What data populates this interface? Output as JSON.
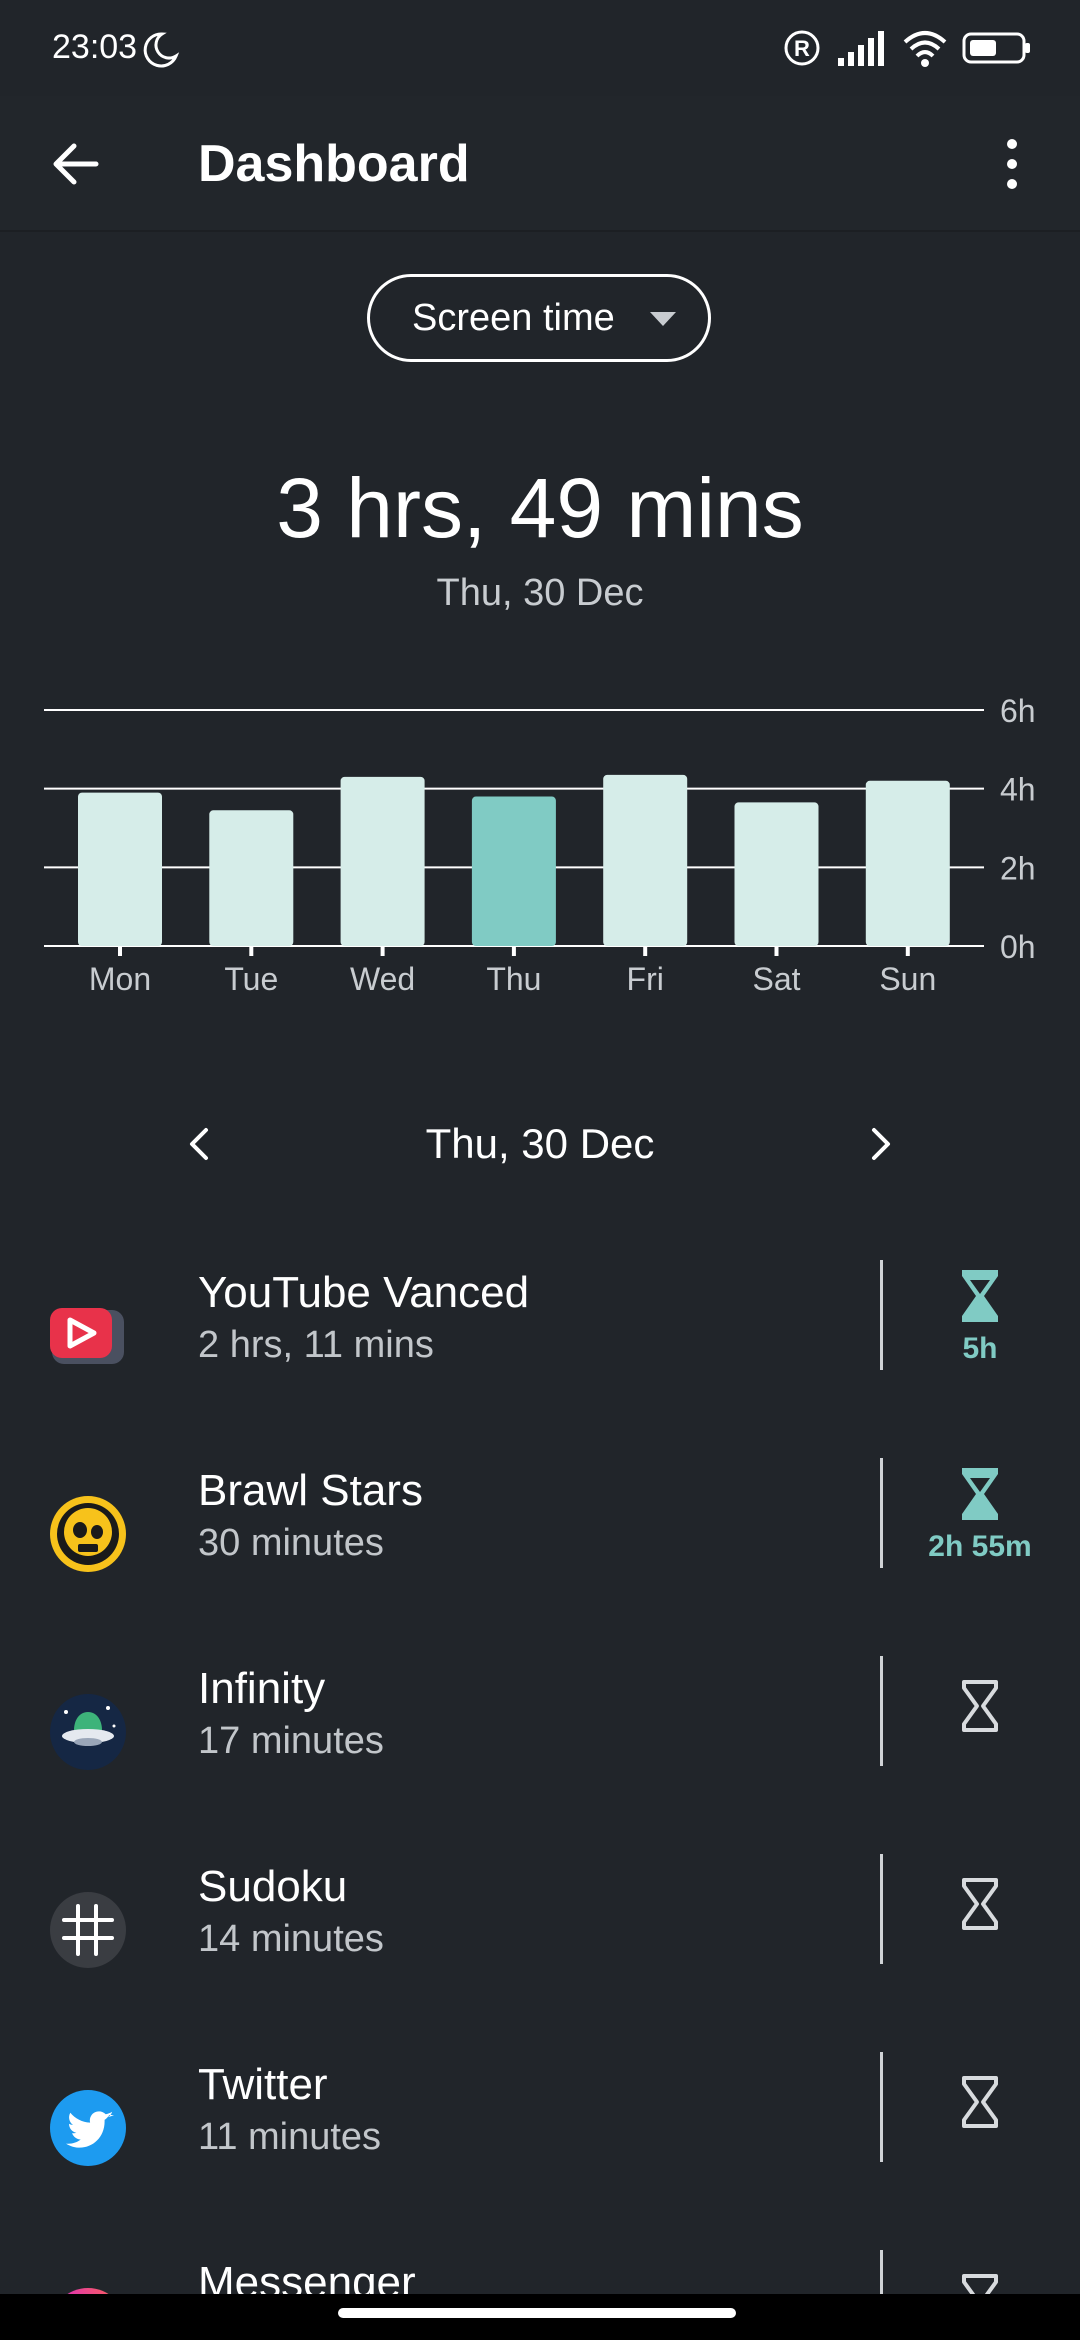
{
  "status_bar": {
    "time": "23:03"
  },
  "app_bar": {
    "title": "Dashboard"
  },
  "metric_select": {
    "label": "Screen time"
  },
  "summary": {
    "total": "3 hrs, 49 mins",
    "date": "Thu, 30 Dec"
  },
  "chart_data": {
    "type": "bar",
    "categories": [
      "Mon",
      "Tue",
      "Wed",
      "Thu",
      "Fri",
      "Sat",
      "Sun"
    ],
    "values": [
      3.9,
      3.45,
      4.3,
      3.8,
      4.35,
      3.65,
      4.2
    ],
    "selected_index": 3,
    "y_ticks": [
      "0h",
      "2h",
      "4h",
      "6h"
    ],
    "ylim": [
      0,
      6
    ],
    "colors": {
      "bar": "#d6ede9",
      "selected": "#80cbc4",
      "grid": "#ffffff"
    }
  },
  "date_nav": {
    "date": "Thu, 30 Dec"
  },
  "apps": [
    {
      "name": "YouTube Vanced",
      "usage": "2 hrs, 11 mins",
      "timer": "5h",
      "timer_set": true,
      "icon": "youtube-vanced-icon"
    },
    {
      "name": "Brawl Stars",
      "usage": "30 minutes",
      "timer": "2h 55m",
      "timer_set": true,
      "icon": "brawl-stars-icon"
    },
    {
      "name": "Infinity",
      "usage": "17 minutes",
      "timer": "",
      "timer_set": false,
      "icon": "infinity-app-icon"
    },
    {
      "name": "Sudoku",
      "usage": "14 minutes",
      "timer": "",
      "timer_set": false,
      "icon": "sudoku-icon"
    },
    {
      "name": "Twitter",
      "usage": "11 minutes",
      "timer": "",
      "timer_set": false,
      "icon": "twitter-icon"
    },
    {
      "name": "Messenger",
      "usage": "",
      "timer": "",
      "timer_set": false,
      "icon": "messenger-icon"
    }
  ]
}
